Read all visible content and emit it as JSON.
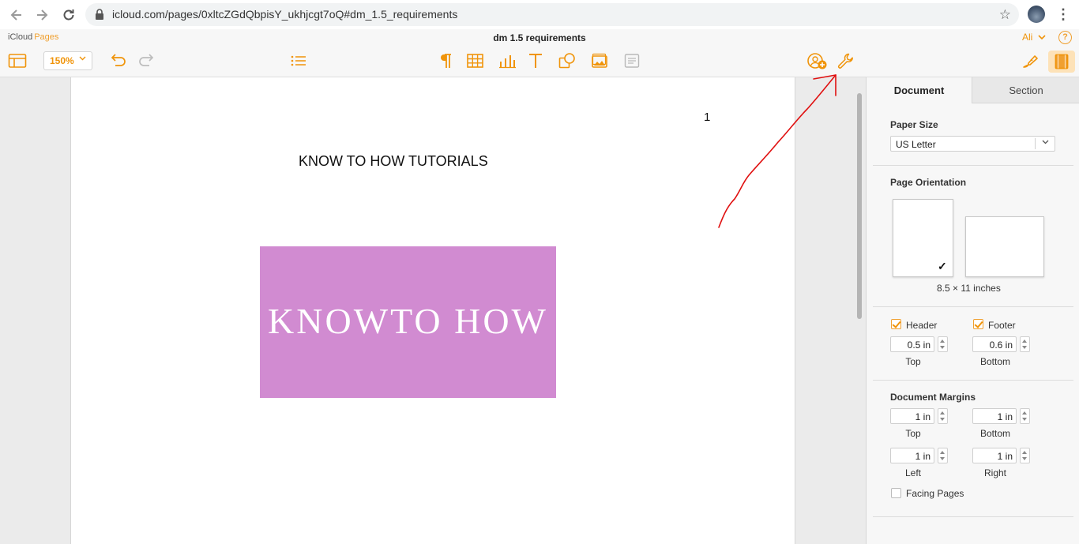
{
  "browser": {
    "url": "icloud.com/pages/0xltcZGdQbpisY_ukhjcgt7oQ#dm_1.5_requirements"
  },
  "app": {
    "brand_icloud": "iCloud",
    "brand_pages": "Pages",
    "doc_title": "dm 1.5 requirements",
    "user_name": "Ali",
    "help_label": "?"
  },
  "toolbar": {
    "zoom_value": "150%",
    "accent_color": "#f0940a"
  },
  "document": {
    "page_number": "1",
    "heading": "KNOW TO HOW TUTORIALS",
    "banner_text": "KNOWTO HOW",
    "banner_color": "#d18bd1"
  },
  "inspector": {
    "tabs": [
      {
        "label": "Document",
        "selected": true
      },
      {
        "label": "Section",
        "selected": false
      }
    ],
    "paper_size_label": "Paper Size",
    "paper_size_value": "US Letter",
    "orientation_label": "Page Orientation",
    "orientation_size": "8.5 × 11 inches",
    "header": {
      "label": "Header",
      "checked": true,
      "value": "0.5 in",
      "caption": "Top"
    },
    "footer": {
      "label": "Footer",
      "checked": true,
      "value": "0.6 in",
      "caption": "Bottom"
    },
    "margins_label": "Document Margins",
    "margins": {
      "top": {
        "value": "1 in",
        "caption": "Top"
      },
      "bottom": {
        "value": "1 in",
        "caption": "Bottom"
      },
      "left": {
        "value": "1 in",
        "caption": "Left"
      },
      "right": {
        "value": "1 in",
        "caption": "Right"
      }
    },
    "facing_pages": {
      "label": "Facing Pages",
      "checked": false
    }
  }
}
